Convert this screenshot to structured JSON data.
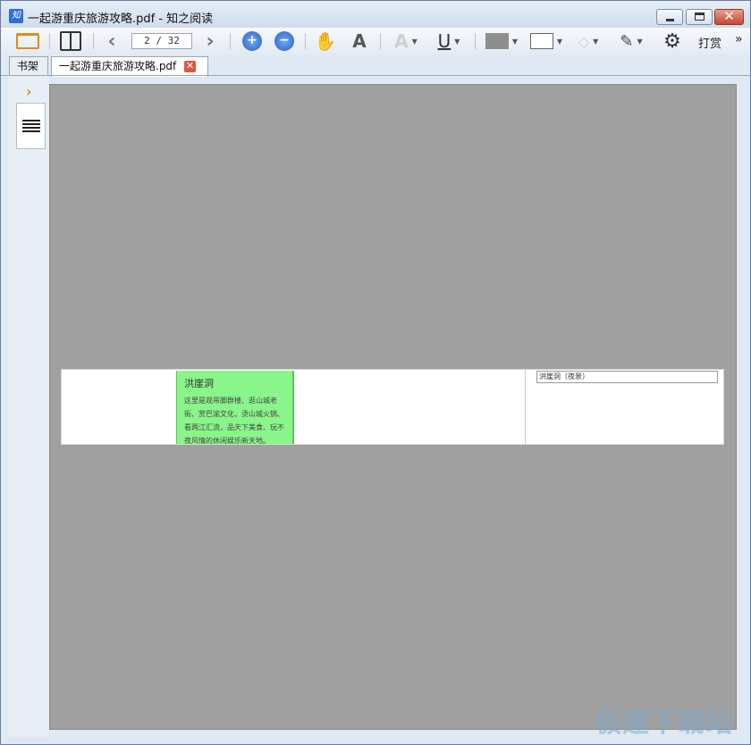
{
  "window": {
    "title": "一起游重庆旅游攻略.pdf - 知之阅读",
    "app_icon_glyph": "知"
  },
  "toolbar": {
    "page_indicator": "2 / 32",
    "reward_label": "打赏",
    "more_glyph": "»",
    "dropdown_glyph": "▼"
  },
  "tabs": {
    "bookshelf": "书架",
    "document": "一起游重庆旅游攻略.pdf",
    "close_glyph": "✕"
  },
  "sidebar": {
    "expand_glyph": "›"
  },
  "document": {
    "highlight_title": "洪崖洞",
    "highlight_body": "这里是观吊脚群楼、逛山城老街、赏巴渝文化，烫山城火锅、看两江汇流，品天下美食、玩不夜风情的休闲娱乐新天地。",
    "photo_caption": "洪崖洞（夜景）"
  },
  "watermark": "极速下载站",
  "colors": {
    "accent_orange": "#e88b12",
    "highlight_green": "#8af58a",
    "viewport_gray": "#a0a0a0",
    "close_red": "#c6462f"
  }
}
